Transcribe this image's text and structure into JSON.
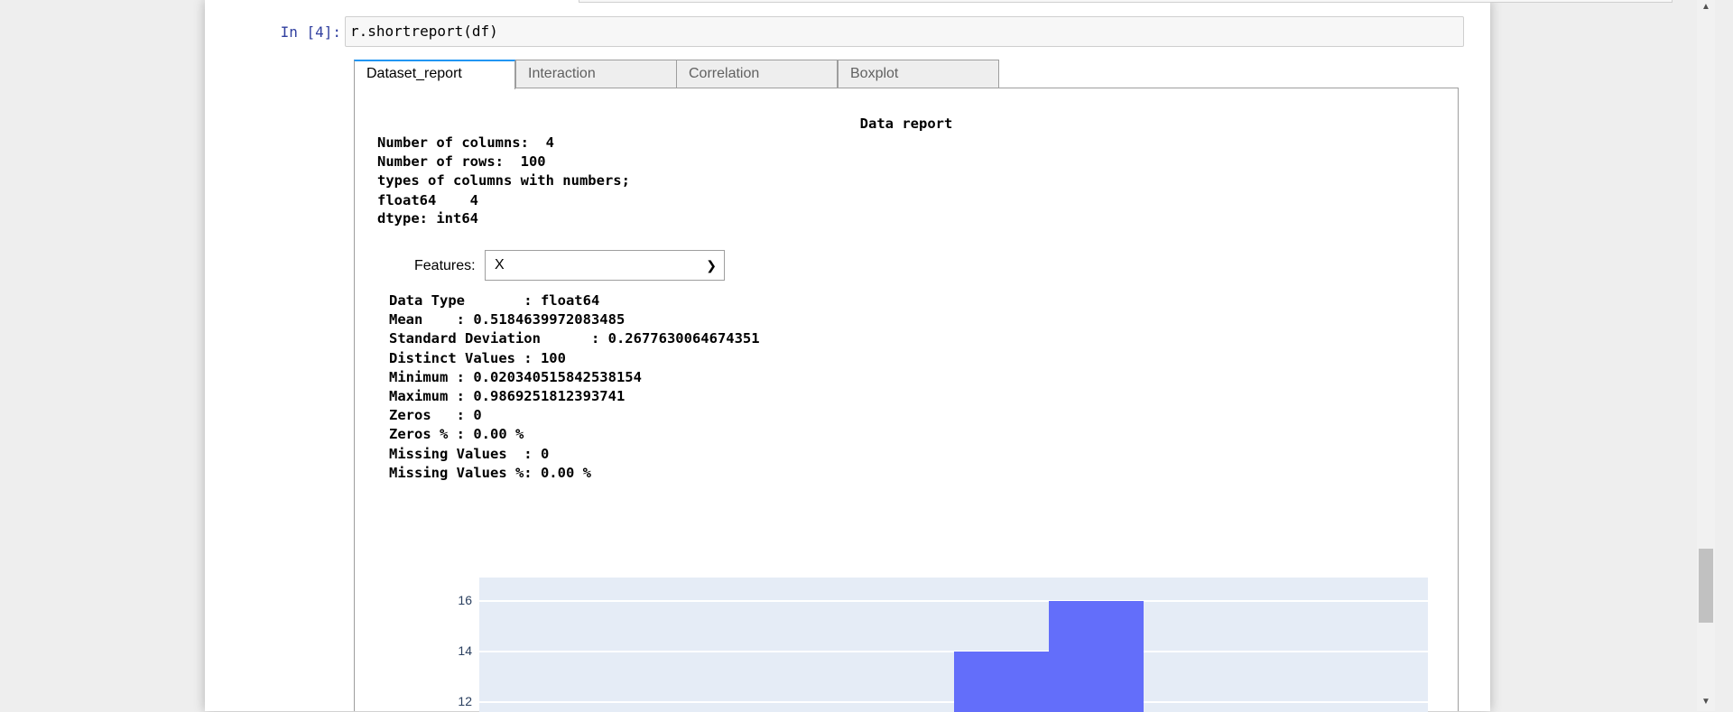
{
  "cell": {
    "prompt": "In [4]:",
    "code": "r.shortreport(df)"
  },
  "tabs": [
    "Dataset_report",
    "Interaction",
    "Correlation",
    "Boxplot"
  ],
  "active_tab": "Dataset_report",
  "report": {
    "title": "Data report",
    "lines": [
      "Number of columns:  4",
      "Number of rows:  100",
      "types of columns with numbers;",
      "float64    4",
      "dtype: int64"
    ]
  },
  "features": {
    "label": "Features:",
    "value": "X"
  },
  "stats": [
    "Data Type       : float64",
    "Mean    : 0.5184639972083485",
    "Standard Deviation      : 0.2677630064674351",
    "Distinct Values : 100",
    "Minimum : 0.020340515842538154",
    "Maximum : 0.9869251812393741",
    "Zeros   : 0",
    "Zeros % : 0.00 %",
    "Missing Values  : 0",
    "Missing Values %: 0.00 %"
  ],
  "chart_data": {
    "type": "bar",
    "title": "",
    "bins": [
      {
        "x0": 0.5,
        "x1": 0.6,
        "count": 14
      },
      {
        "x0": 0.6,
        "x1": 0.7,
        "count": 16
      }
    ],
    "xlim": [
      0,
      1
    ],
    "ylim_visible": [
      11.8,
      16.9
    ],
    "yticks": [
      "16",
      "14",
      "12"
    ],
    "color": "#636efa",
    "grid": true
  }
}
